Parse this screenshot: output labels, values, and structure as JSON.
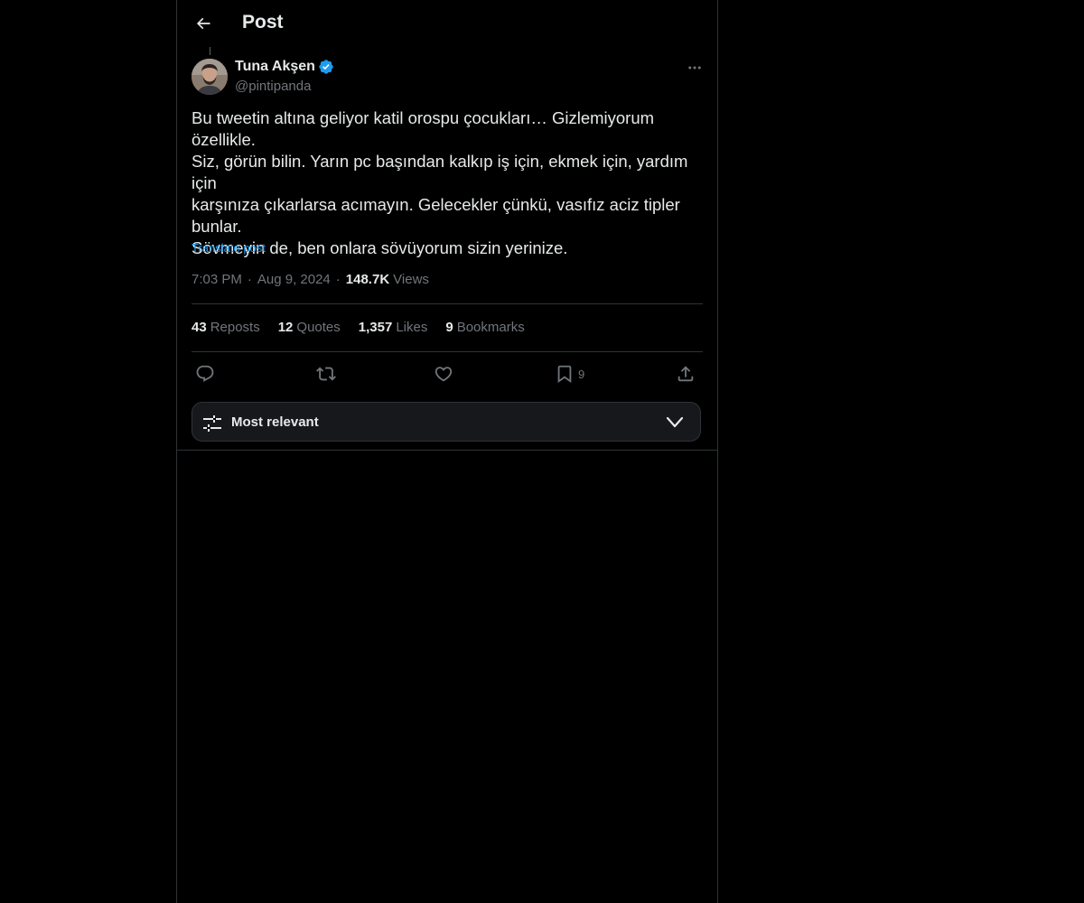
{
  "header": {
    "title": "Post"
  },
  "author": {
    "name": "Tuna Akşen",
    "handle": "@pintipanda",
    "verified": true,
    "avatar": "avatar-photo"
  },
  "post": {
    "text": "Bu tweetin altına geliyor katil orospu çocukları… Gizlemiyorum\nözellikle.\nSiz, görün bilin. Yarın pc başından kalkıp iş için, ekmek için, yardım için\nkarşınıza çıkarlarsa acımayın. Gelecekler çünkü, vasıfız aciz tipler\nbunlar.\nSövmeyin de, ben onlara sövüyorum sizin yerinize.",
    "translate_label": "Translate post",
    "time": "7:03 PM",
    "date": "Aug 9, 2024",
    "separator": "·",
    "views_count": "148.7K",
    "views_label": "Views"
  },
  "stats": {
    "reposts": {
      "count": "43",
      "label": "Reposts"
    },
    "quotes": {
      "count": "12",
      "label": "Quotes"
    },
    "likes": {
      "count": "1,357",
      "label": "Likes"
    },
    "bookmarks": {
      "count": "9",
      "label": "Bookmarks"
    }
  },
  "actions": {
    "bookmark_count": "9"
  },
  "sort": {
    "label": "Most relevant"
  },
  "colors": {
    "background": "#000000",
    "text": "#e7e9ea",
    "muted": "#71767b",
    "accent": "#1d9bf0",
    "border": "#2f3336",
    "sort_bg": "#16181c"
  }
}
